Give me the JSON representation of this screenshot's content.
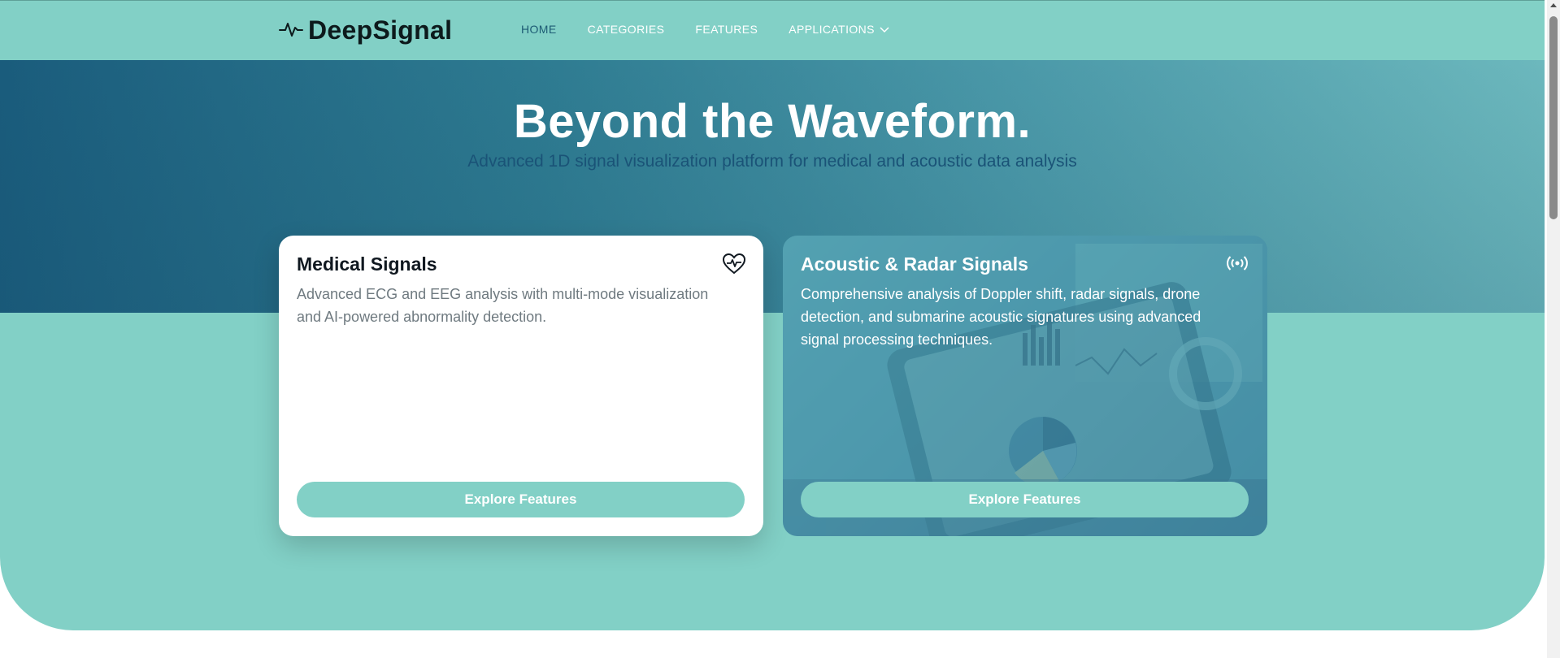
{
  "brand": {
    "name": "DeepSignal",
    "logo_icon": "pulse-icon"
  },
  "nav": {
    "items": [
      {
        "label": "HOME",
        "active": true
      },
      {
        "label": "CATEGORIES",
        "active": false
      },
      {
        "label": "FEATURES",
        "active": false
      },
      {
        "label": "APPLICATIONS",
        "active": false,
        "icon": "chevron-down-icon"
      }
    ]
  },
  "hero": {
    "title": "Beyond the Waveform.",
    "subtitle": "Advanced 1D signal visualization platform for medical and acoustic data analysis"
  },
  "cards": [
    {
      "title": "Medical Signals",
      "description": "Advanced ECG and EEG analysis with multi-mode visualization and AI-powered abnormality detection.",
      "icon": "heart-pulse-icon",
      "button": "Explore Features"
    },
    {
      "title": "Acoustic & Radar Signals",
      "description": "Comprehensive analysis of Doppler shift, radar signals, drone detection, and submarine acoustic signatures using advanced signal processing techniques.",
      "icon": "broadcast-icon",
      "button": "Explore Features"
    }
  ],
  "colors": {
    "teal": "#82d0c6",
    "hero_dark": "#1a5c7c",
    "subtitle": "#1a5377",
    "white": "#ffffff",
    "active_nav": "#1d5b74"
  }
}
